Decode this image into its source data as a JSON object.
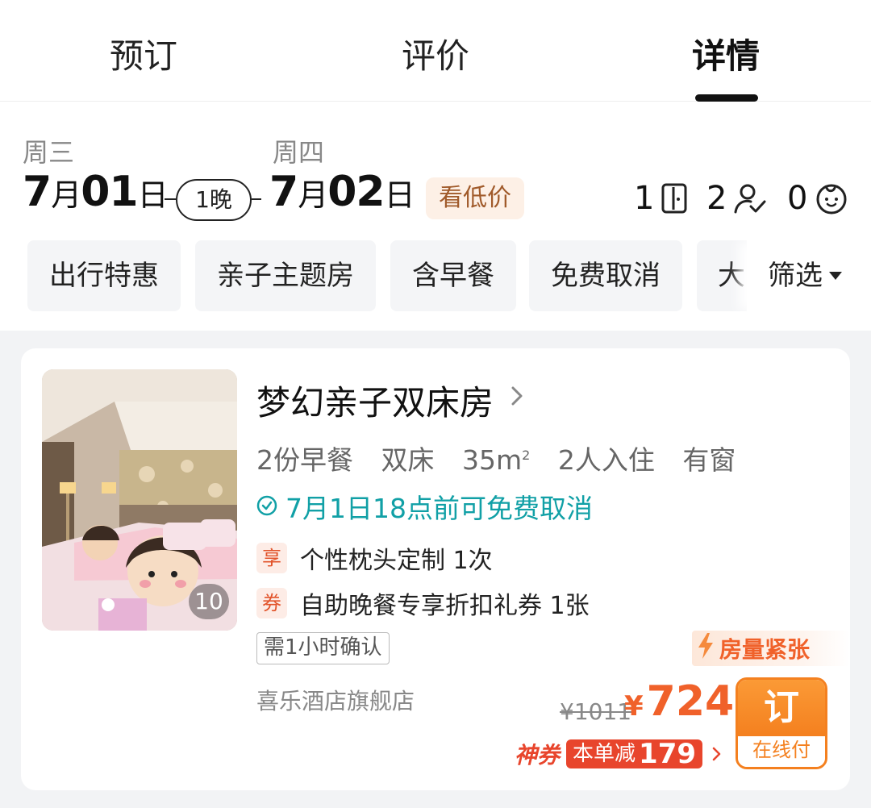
{
  "tabs": [
    {
      "label": "预订",
      "active": false
    },
    {
      "label": "评价",
      "active": false
    },
    {
      "label": "详情",
      "active": true
    }
  ],
  "stay": {
    "checkin_weekday": "周三",
    "checkin_month": "7",
    "checkin_day": "01",
    "checkout_weekday": "周四",
    "checkout_month": "7",
    "checkout_day": "02",
    "month_unit": "月",
    "day_unit": "日",
    "nights_label": "1晚",
    "low_price_label": "看低价"
  },
  "occupancy": {
    "rooms": "1",
    "adults": "2",
    "children": "0",
    "rooms_icon": "door-icon",
    "adults_icon": "adult-icon",
    "children_icon": "child-icon"
  },
  "filters": {
    "chips": [
      "出行特惠",
      "亲子主题房",
      "含早餐",
      "免费取消",
      "大"
    ],
    "filter_label": "筛选"
  },
  "room": {
    "photo_count": "10",
    "title": "梦幻亲子双床房",
    "features": [
      "2份早餐",
      "双床",
      "35m",
      "2人入住",
      "有窗"
    ],
    "area_sup": "2",
    "cancel_policy": "7月1日18点前可免费取消",
    "perks": [
      {
        "tag": "享",
        "text": "个性枕头定制 1次"
      },
      {
        "tag": "券",
        "text": "自助晚餐专享折扣礼券 1张"
      }
    ],
    "confirm_label": "需1小时确认",
    "store": "喜乐酒店旗舰店",
    "urgency": "房量紧张",
    "original_price": "¥1011",
    "currency": "¥",
    "price": "724",
    "coupon_brand": "神券",
    "coupon_prefix": "本单减",
    "coupon_amount": "179",
    "book_label": "订",
    "pay_label": "在线付"
  },
  "colors": {
    "accent_orange": "#f0612a",
    "teal": "#11a0a6",
    "coupon_red": "#e8452c"
  }
}
